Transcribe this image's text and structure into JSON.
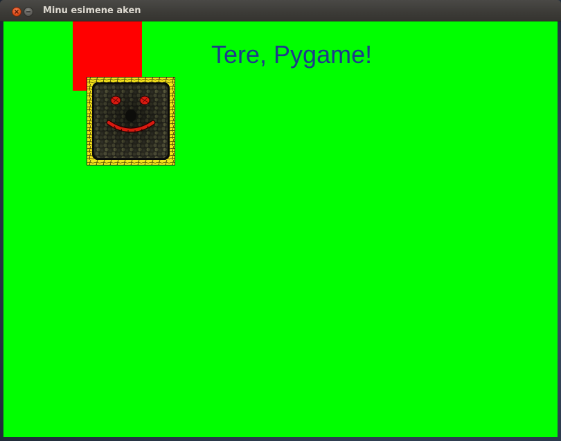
{
  "window": {
    "title": "Minu esimene aken"
  },
  "titlebar": {
    "close_icon": "close-icon",
    "minimize_icon": "minimize-icon"
  },
  "canvas": {
    "background_color": "#00ff00",
    "text": "Tere, Pygame!",
    "text_color": "#1e3a8a",
    "rect_color": "#ff0000",
    "sprite_icon": "smiley-mosaic-icon"
  }
}
